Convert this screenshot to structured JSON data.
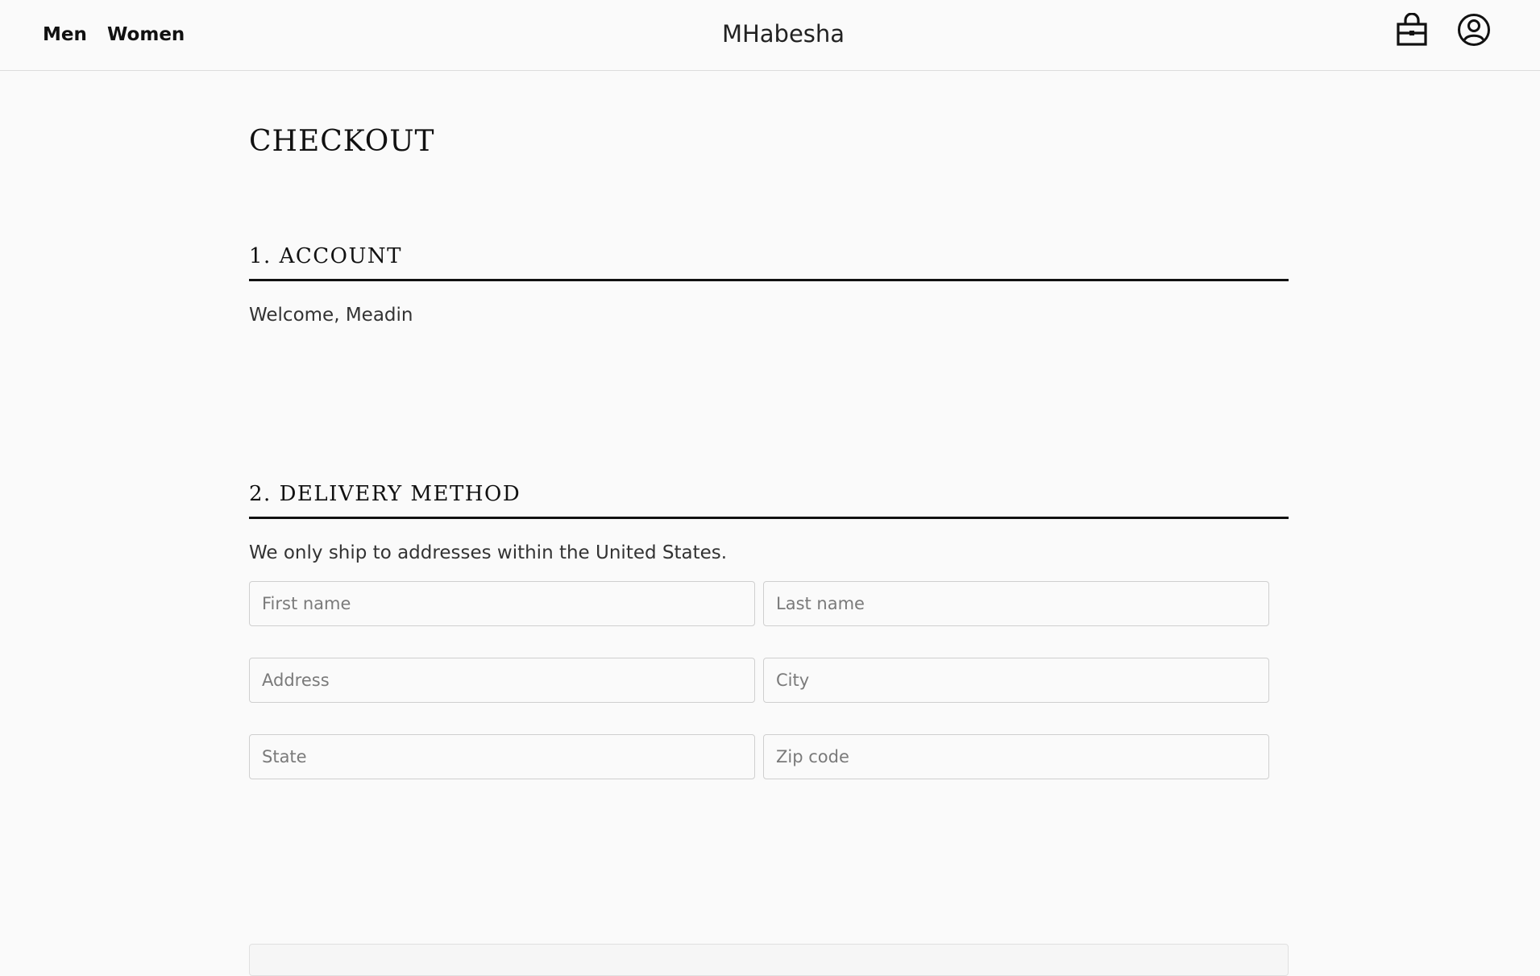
{
  "header": {
    "nav": [
      {
        "label": "Men"
      },
      {
        "label": "Women"
      }
    ],
    "brand": "MHabesha",
    "icons": {
      "bag": "shopping-bag-icon",
      "account": "account-circle-icon"
    }
  },
  "checkout": {
    "title": "CHECKOUT",
    "account_section": {
      "heading": "1. ACCOUNT",
      "welcome": "Welcome, Meadin"
    },
    "delivery_section": {
      "heading": "2. DELIVERY METHOD",
      "note": "We only ship to addresses within the United States.",
      "fields": {
        "first_name": {
          "placeholder": "First name",
          "value": ""
        },
        "last_name": {
          "placeholder": "Last name",
          "value": ""
        },
        "address": {
          "placeholder": "Address",
          "value": ""
        },
        "city": {
          "placeholder": "City",
          "value": ""
        },
        "state": {
          "placeholder": "State",
          "value": ""
        },
        "zip": {
          "placeholder": "Zip code",
          "value": ""
        }
      }
    }
  },
  "colors": {
    "background": "#fafafa",
    "text": "#111111",
    "rule": "#111111",
    "input_border": "#cfcfcf"
  }
}
